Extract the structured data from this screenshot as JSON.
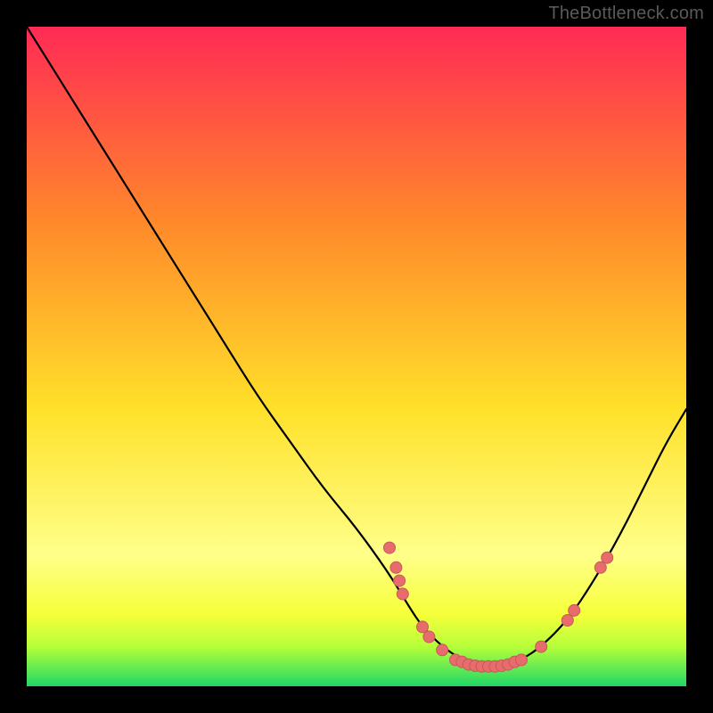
{
  "watermark": "TheBottleneck.com",
  "colors": {
    "frame_bg": "#000000",
    "watermark": "#5a5a5a",
    "curve": "#000000",
    "marker_fill": "#e86c6c",
    "marker_stroke": "#c45a5a",
    "gradient_top": "#ff2a55",
    "gradient_mid1": "#ff8a2a",
    "gradient_mid2": "#ffe12a",
    "gradient_low": "#ffff8a",
    "gradient_band_yellow": "#f6ff3a",
    "gradient_band_lime": "#b6ff3a",
    "gradient_bottom": "#1fd867"
  },
  "chart_data": {
    "type": "line",
    "title": "",
    "xlabel": "",
    "ylabel": "",
    "xlim": [
      0,
      100
    ],
    "ylim": [
      0,
      100
    ],
    "curve": {
      "x": [
        0,
        5,
        10,
        15,
        20,
        25,
        30,
        35,
        40,
        45,
        50,
        55,
        58,
        60,
        63,
        66,
        69,
        72,
        75,
        78,
        82,
        86,
        90,
        94,
        97,
        100
      ],
      "y": [
        100,
        92,
        84,
        76,
        68,
        60,
        52,
        44,
        37,
        30,
        24,
        17,
        12,
        9,
        6,
        4,
        3,
        3,
        4,
        6,
        10,
        16,
        23,
        31,
        37,
        42
      ]
    },
    "markers": [
      {
        "x": 55,
        "y": 21
      },
      {
        "x": 56,
        "y": 18
      },
      {
        "x": 56.5,
        "y": 16
      },
      {
        "x": 57,
        "y": 14
      },
      {
        "x": 60,
        "y": 9
      },
      {
        "x": 61,
        "y": 7.5
      },
      {
        "x": 63,
        "y": 5.5
      },
      {
        "x": 65,
        "y": 4
      },
      {
        "x": 66,
        "y": 3.7
      },
      {
        "x": 67,
        "y": 3.3
      },
      {
        "x": 68,
        "y": 3.1
      },
      {
        "x": 69,
        "y": 3
      },
      {
        "x": 70,
        "y": 3
      },
      {
        "x": 71,
        "y": 3
      },
      {
        "x": 72,
        "y": 3.1
      },
      {
        "x": 73,
        "y": 3.3
      },
      {
        "x": 74,
        "y": 3.7
      },
      {
        "x": 75,
        "y": 4
      },
      {
        "x": 78,
        "y": 6
      },
      {
        "x": 82,
        "y": 10
      },
      {
        "x": 83,
        "y": 11.5
      },
      {
        "x": 87,
        "y": 18
      },
      {
        "x": 88,
        "y": 19.5
      }
    ]
  }
}
